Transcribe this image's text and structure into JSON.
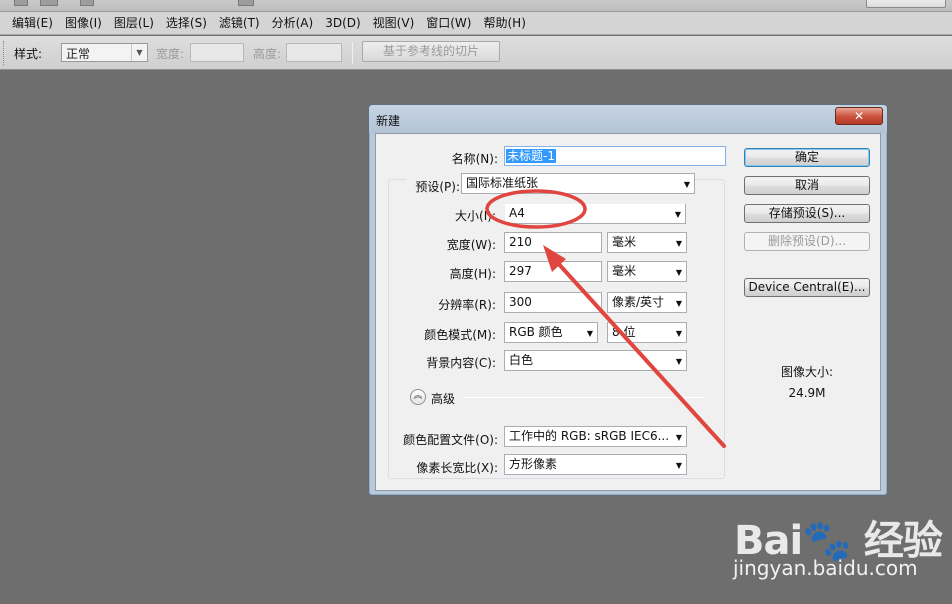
{
  "menu": [
    "编辑(E)",
    "图像(I)",
    "图层(L)",
    "选择(S)",
    "滤镜(T)",
    "分析(A)",
    "3D(D)",
    "视图(V)",
    "窗口(W)",
    "帮助(H)"
  ],
  "options": {
    "style_label": "样式:",
    "style_value": "正常",
    "width_label": "宽度:",
    "height_label": "高度:",
    "slice_button": "基于参考线的切片"
  },
  "dialog": {
    "title": "新建",
    "close_glyph": "✕",
    "name_label": "名称(N):",
    "name_value": "未标题-1",
    "preset_label": "预设(P):",
    "preset_value": "国际标准纸张",
    "size_label": "大小(I):",
    "size_value": "A4",
    "width_label": "宽度(W):",
    "width_value": "210",
    "width_unit": "毫米",
    "height_label": "高度(H):",
    "height_value": "297",
    "height_unit": "毫米",
    "resolution_label": "分辨率(R):",
    "resolution_value": "300",
    "resolution_unit": "像素/英寸",
    "color_mode_label": "颜色模式(M):",
    "color_mode_value": "RGB 颜色",
    "bit_depth_value": "8 位",
    "background_label": "背景内容(C):",
    "background_value": "白色",
    "advanced_label": "高级",
    "color_profile_label": "颜色配置文件(O):",
    "color_profile_value": "工作中的 RGB: sRGB IEC6...",
    "aspect_label": "像素长宽比(X):",
    "aspect_value": "方形像素",
    "buttons": {
      "ok": "确定",
      "cancel": "取消",
      "save_preset": "存储预设(S)...",
      "delete_preset": "删除预设(D)...",
      "device_central": "Device Central(E)..."
    },
    "image_size_label": "图像大小:",
    "image_size_value": "24.9M"
  },
  "watermark": {
    "logo": "Bai🐾 经验",
    "url": "jingyan.baidu.com"
  },
  "colors": {
    "annotation_red": "#e0463f",
    "canvas_gray": "#6e6e6e"
  }
}
